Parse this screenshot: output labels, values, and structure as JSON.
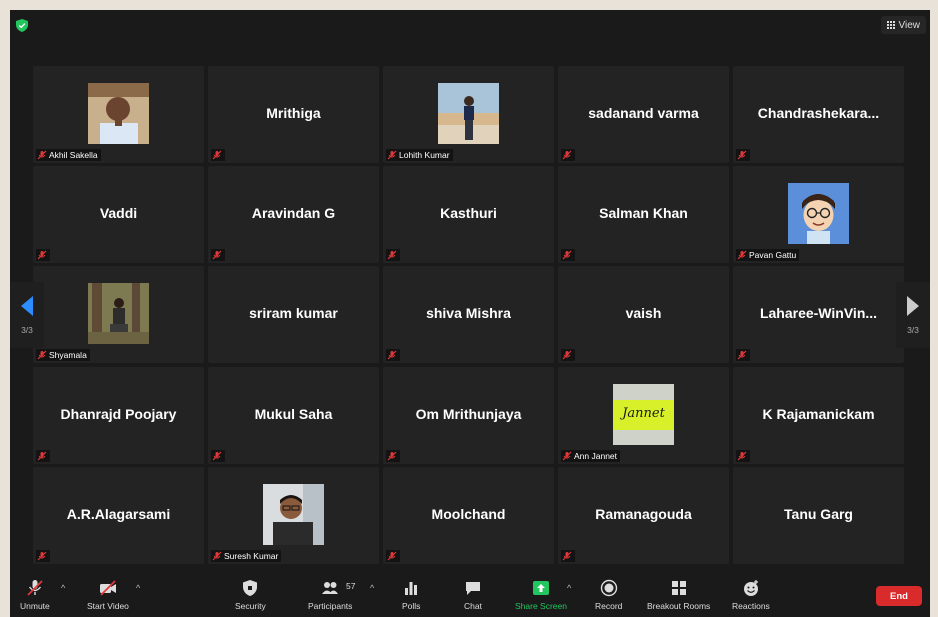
{
  "top": {
    "view_label": "View"
  },
  "tiles": [
    {
      "name": "Akhil Sakella",
      "has_photo": true
    },
    {
      "name": "Mrithiga",
      "has_photo": false
    },
    {
      "name": "Lohith Kumar",
      "has_photo": true
    },
    {
      "name": "sadanand varma",
      "has_photo": false
    },
    {
      "name": "Chandrashekara...",
      "has_photo": false
    },
    {
      "name": "Vaddi",
      "has_photo": false
    },
    {
      "name": "Aravindan G",
      "has_photo": false
    },
    {
      "name": "Kasthuri",
      "has_photo": false
    },
    {
      "name": "Salman Khan",
      "has_photo": false
    },
    {
      "name": "Pavan Gattu",
      "has_photo": true
    },
    {
      "name": "Shyamala",
      "has_photo": true
    },
    {
      "name": "sriram kumar",
      "has_photo": false
    },
    {
      "name": "shiva Mishra",
      "has_photo": false
    },
    {
      "name": "vaish",
      "has_photo": false
    },
    {
      "name": "Laharee-WinVin...",
      "has_photo": false
    },
    {
      "name": "Dhanrajd Poojary",
      "has_photo": false
    },
    {
      "name": "Mukul Saha",
      "has_photo": false
    },
    {
      "name": "Om Mrithunjaya",
      "has_photo": false
    },
    {
      "name": "Ann Jannet",
      "has_photo": true,
      "photo_text": "Jannet"
    },
    {
      "name": "K Rajamanickam",
      "has_photo": false
    },
    {
      "name": "A.R.Alagarsami",
      "has_photo": false
    },
    {
      "name": "Suresh Kumar",
      "has_photo": true
    },
    {
      "name": "Moolchand",
      "has_photo": false
    },
    {
      "name": "Ramanagouda",
      "has_photo": false
    },
    {
      "name": "Tanu Garg",
      "has_photo": false
    }
  ],
  "pager": {
    "prev_label": "3/3",
    "next_label": "3/3"
  },
  "toolbar": {
    "unmute": "Unmute",
    "start_video": "Start Video",
    "security": "Security",
    "participants": "Participants",
    "participants_count": "57",
    "polls": "Polls",
    "chat": "Chat",
    "share_screen": "Share Screen",
    "record": "Record",
    "breakout_rooms": "Breakout Rooms",
    "reactions": "Reactions",
    "end": "End"
  },
  "colors": {
    "accent_green": "#22c55e",
    "end_red": "#d92b2b",
    "muted_red": "#e0393a",
    "nav_blue": "#2d8cff"
  }
}
